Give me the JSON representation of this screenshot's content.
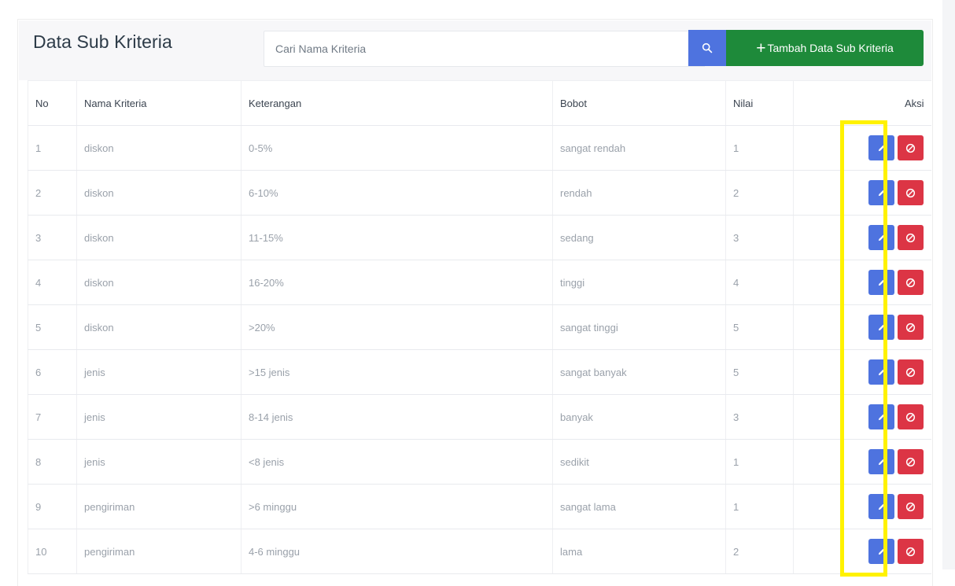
{
  "header": {
    "title": "Data Sub Kriteria",
    "search_placeholder": "Cari Nama Kriteria",
    "add_button_symbol": "+",
    "add_button_label": "Tambah Data Sub Kriteria"
  },
  "table": {
    "columns": [
      "No",
      "Nama Kriteria",
      "Keterangan",
      "Bobot",
      "Nilai",
      "Aksi"
    ],
    "rows": [
      {
        "no": "1",
        "nama": "diskon",
        "keterangan": "0-5%",
        "bobot": "sangat rendah",
        "nilai": "1"
      },
      {
        "no": "2",
        "nama": "diskon",
        "keterangan": "6-10%",
        "bobot": "rendah",
        "nilai": "2"
      },
      {
        "no": "3",
        "nama": "diskon",
        "keterangan": "11-15%",
        "bobot": "sedang",
        "nilai": "3"
      },
      {
        "no": "4",
        "nama": "diskon",
        "keterangan": "16-20%",
        "bobot": "tinggi",
        "nilai": "4"
      },
      {
        "no": "5",
        "nama": "diskon",
        "keterangan": ">20%",
        "bobot": "sangat tinggi",
        "nilai": "5"
      },
      {
        "no": "6",
        "nama": "jenis",
        "keterangan": ">15 jenis",
        "bobot": "sangat banyak",
        "nilai": "5"
      },
      {
        "no": "7",
        "nama": "jenis",
        "keterangan": "8-14 jenis",
        "bobot": "banyak",
        "nilai": "3"
      },
      {
        "no": "8",
        "nama": "jenis",
        "keterangan": "<8 jenis",
        "bobot": "sedikit",
        "nilai": "1"
      },
      {
        "no": "9",
        "nama": "pengiriman",
        "keterangan": ">6 minggu",
        "bobot": "sangat lama",
        "nilai": "1"
      },
      {
        "no": "10",
        "nama": "pengiriman",
        "keterangan": "4-6 minggu",
        "bobot": "lama",
        "nilai": "2"
      }
    ]
  },
  "icons": {
    "search": "search-icon",
    "edit": "pencil-icon",
    "delete": "ban-icon"
  },
  "colors": {
    "primary": "#4e73df",
    "success": "#1e8a3a",
    "danger": "#dc3545",
    "highlight": "#fff200"
  }
}
